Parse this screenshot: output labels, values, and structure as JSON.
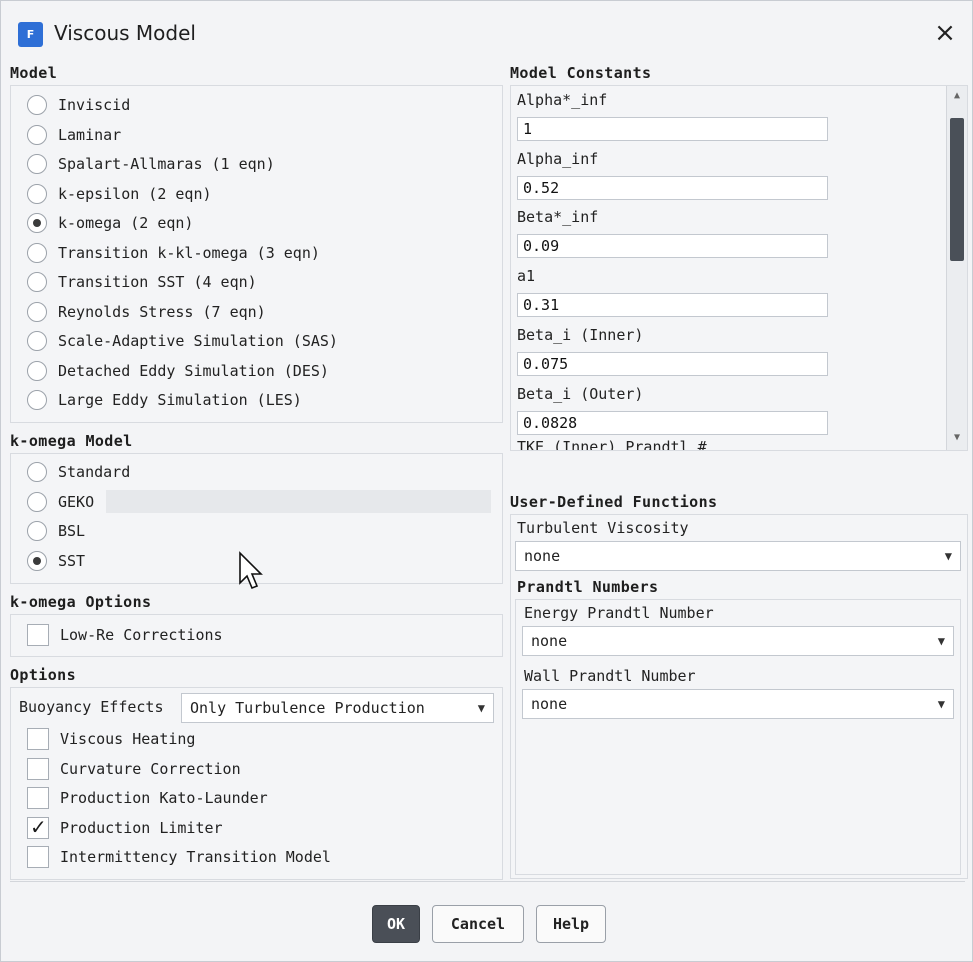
{
  "window": {
    "title": "Viscous Model",
    "icon": "fluent-app-icon",
    "close": "×"
  },
  "model": {
    "title": "Model",
    "options": [
      {
        "label": "Inviscid",
        "selected": false
      },
      {
        "label": "Laminar",
        "selected": false
      },
      {
        "label": "Spalart-Allmaras (1 eqn)",
        "selected": false
      },
      {
        "label": "k-epsilon (2 eqn)",
        "selected": false
      },
      {
        "label": "k-omega (2 eqn)",
        "selected": true
      },
      {
        "label": "Transition k-kl-omega (3 eqn)",
        "selected": false
      },
      {
        "label": "Transition SST (4 eqn)",
        "selected": false
      },
      {
        "label": "Reynolds Stress (7 eqn)",
        "selected": false
      },
      {
        "label": "Scale-Adaptive Simulation (SAS)",
        "selected": false
      },
      {
        "label": "Detached Eddy Simulation (DES)",
        "selected": false
      },
      {
        "label": "Large Eddy Simulation (LES)",
        "selected": false
      }
    ]
  },
  "komega_model": {
    "title": "k-omega Model",
    "options": [
      {
        "label": "Standard",
        "selected": false
      },
      {
        "label": "GEKO",
        "selected": false
      },
      {
        "label": "BSL",
        "selected": false
      },
      {
        "label": "SST",
        "selected": true
      }
    ]
  },
  "komega_options": {
    "title": "k-omega Options",
    "low_re": {
      "label": "Low-Re Corrections",
      "checked": false
    }
  },
  "options": {
    "title": "Options",
    "buoyancy_label": "Buoyancy Effects",
    "buoyancy_value": "Only Turbulence Production",
    "checks": [
      {
        "label": "Viscous Heating",
        "checked": false
      },
      {
        "label": "Curvature Correction",
        "checked": false
      },
      {
        "label": "Production Kato-Launder",
        "checked": false
      },
      {
        "label": "Production Limiter",
        "checked": true
      },
      {
        "label": "Intermittency Transition Model",
        "checked": false
      }
    ]
  },
  "model_constants": {
    "title": "Model Constants",
    "items": [
      {
        "label": "Alpha*_inf",
        "value": "1"
      },
      {
        "label": "Alpha_inf",
        "value": "0.52"
      },
      {
        "label": "Beta*_inf",
        "value": "0.09"
      },
      {
        "label": "a1",
        "value": "0.31"
      },
      {
        "label": "Beta_i (Inner)",
        "value": "0.075"
      },
      {
        "label": "Beta_i (Outer)",
        "value": "0.0828"
      }
    ],
    "cut_off_label": "TKE (Inner) Prandtl #"
  },
  "udf": {
    "title": "User-Defined Functions",
    "turbulent_viscosity_label": "Turbulent Viscosity",
    "turbulent_viscosity_value": "none",
    "prandtl_title": "Prandtl Numbers",
    "energy_label": "Energy Prandtl Number",
    "energy_value": "none",
    "wall_label": "Wall Prandtl Number",
    "wall_value": "none"
  },
  "buttons": {
    "ok": "OK",
    "cancel": "Cancel",
    "help": "Help"
  }
}
